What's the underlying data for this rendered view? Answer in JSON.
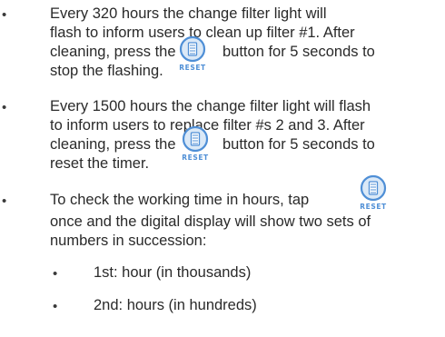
{
  "colors": {
    "text": "#2a2a2a",
    "button_ring": "#4f8fd6",
    "button_inner": "#dbe9f7",
    "button_label": "#4f8fd6"
  },
  "bullet_symbol": "•",
  "reset_button": {
    "icon": "reset-button-icon",
    "label": "RESET"
  },
  "bullets": [
    {
      "lines": [
        "Every 320 hours the change filter light will",
        "flash to inform users to clean up filter #1.  After",
        "cleaning, press the",
        "button for 5 seconds to",
        "stop the flashing."
      ]
    },
    {
      "lines": [
        "Every 1500 hours the change filter light will flash",
        "to inform users to replace filter #s 2 and 3.  After",
        "cleaning, press the",
        "button for 5 seconds to",
        "reset the timer."
      ]
    },
    {
      "lines": [
        "To check the working time in hours, tap",
        "once and the digital display will show two sets of",
        "numbers in succession:"
      ]
    }
  ],
  "sub_bullets": [
    "1st: hour (in thousands)",
    "2nd: hours (in hundreds)"
  ]
}
